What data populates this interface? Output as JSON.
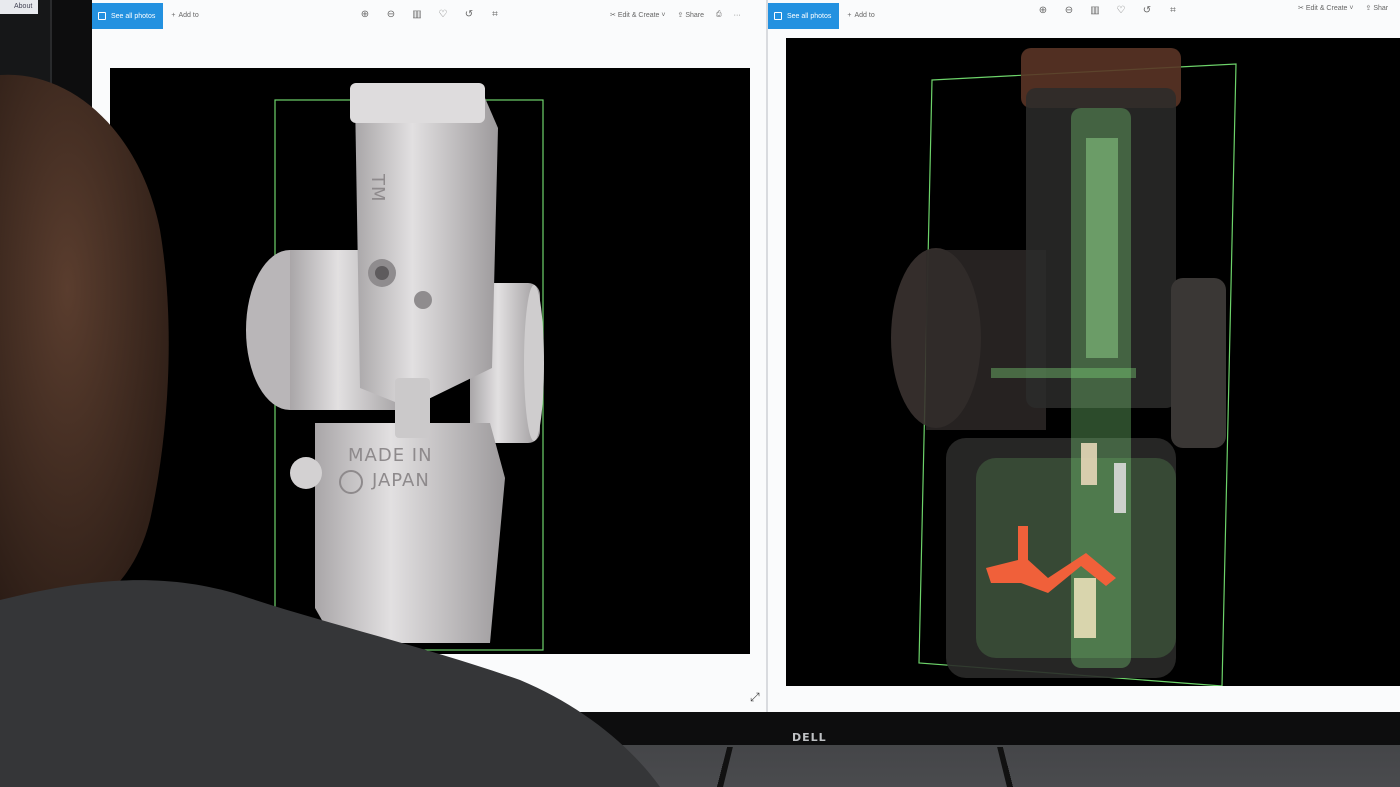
{
  "side_app": {
    "about_label": "About"
  },
  "monitor": {
    "brand": "DELL"
  },
  "left_window": {
    "see_all_label": "See all photos",
    "add_to_label": "Add to",
    "edit_create_label": "Edit & Create",
    "share_label": "Share",
    "more_label": "···",
    "model_text_line1": "MADE IN",
    "model_text_line2": "JAPAN",
    "body_text": "TM"
  },
  "right_window": {
    "see_all_label": "See all photos",
    "add_to_label": "Add to",
    "edit_create_label": "Edit & Create",
    "share_label": "Shar"
  },
  "colors": {
    "accent": "#2391e0",
    "bbox_green": "#6dd36a",
    "highlight_orange": "#f0603a",
    "xray_green": "#7fd67a",
    "model_grey": "#d8d6d7"
  }
}
